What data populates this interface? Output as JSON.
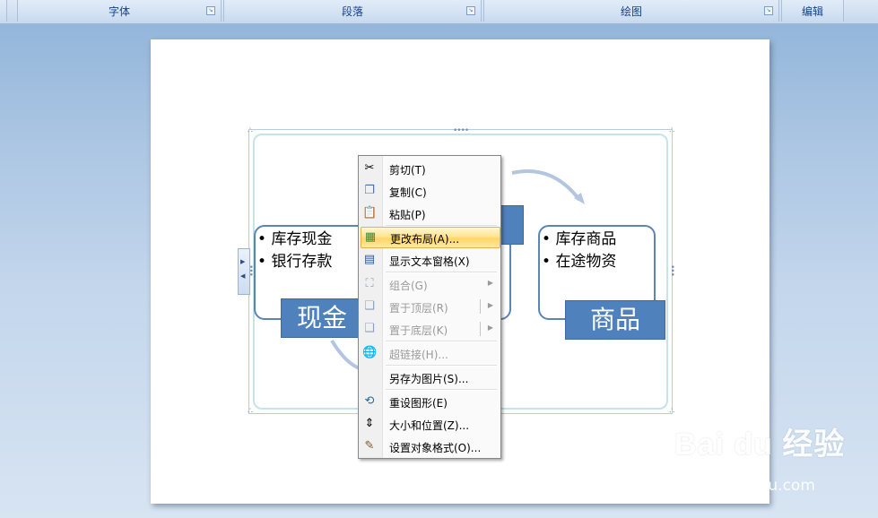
{
  "ribbon": {
    "groups": [
      {
        "label": "字体"
      },
      {
        "label": "段落"
      },
      {
        "label": "绘图"
      },
      {
        "label": "编辑"
      }
    ]
  },
  "smartart": {
    "left_node": {
      "bullets": [
        "库存现金",
        "银行存款"
      ],
      "label": "现金"
    },
    "right_node": {
      "bullets": [
        "库存商品",
        "在途物资"
      ],
      "label": "商品"
    },
    "colors": {
      "accent": "#4f81bd",
      "outline": "#5b84b9",
      "arrow": "#b4c5e0"
    }
  },
  "context_menu": {
    "items": [
      {
        "label": "剪切(T)",
        "icon": "scissors-icon",
        "enabled": true
      },
      {
        "label": "复制(C)",
        "icon": "copy-icon",
        "enabled": true
      },
      {
        "label": "粘贴(P)",
        "icon": "paste-icon",
        "enabled": true
      },
      {
        "label": "更改布局(A)...",
        "icon": "change-layout-icon",
        "enabled": true,
        "highlighted": true
      },
      {
        "label": "显示文本窗格(X)",
        "icon": "text-pane-icon",
        "enabled": true
      },
      {
        "label": "组合(G)",
        "icon": "group-icon",
        "enabled": false,
        "submenu": true
      },
      {
        "label": "置于顶层(R)",
        "icon": "bring-to-front-icon",
        "enabled": false,
        "submenu": true
      },
      {
        "label": "置于底层(K)",
        "icon": "send-to-back-icon",
        "enabled": false,
        "submenu": true
      },
      {
        "label": "超链接(H)...",
        "icon": "hyperlink-icon",
        "enabled": false
      },
      {
        "label": "另存为图片(S)...",
        "icon": "",
        "enabled": true
      },
      {
        "label": "重设图形(E)",
        "icon": "reset-graphic-icon",
        "enabled": true
      },
      {
        "label": "大小和位置(Z)...",
        "icon": "size-position-icon",
        "enabled": true
      },
      {
        "label": "设置对象格式(O)...",
        "icon": "format-object-icon",
        "enabled": true
      }
    ]
  },
  "watermark": {
    "logo": "Bai du 经验",
    "url": "jingyan.baidu.com"
  }
}
